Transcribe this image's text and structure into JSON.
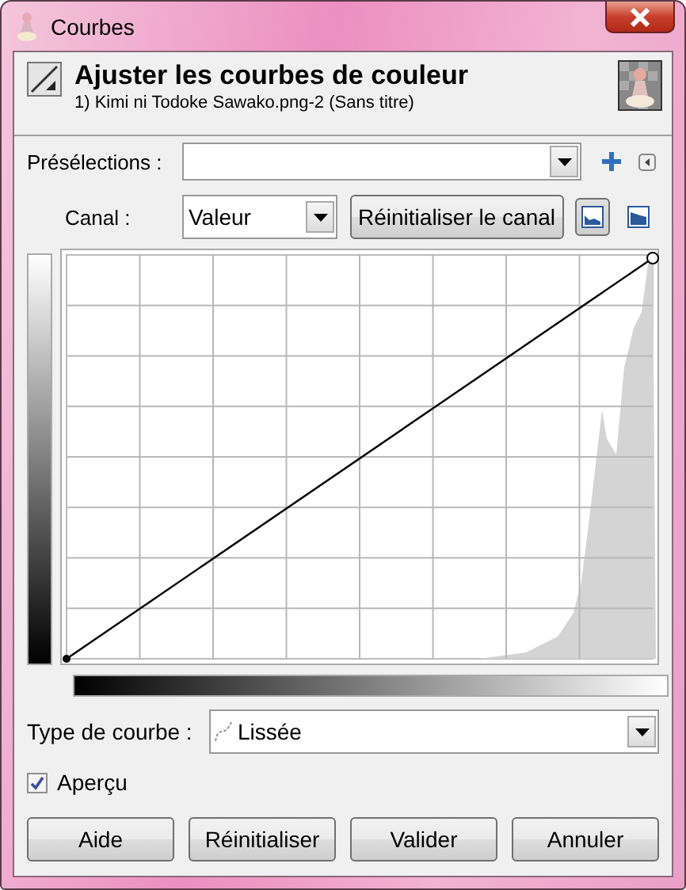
{
  "window": {
    "title": "Courbes"
  },
  "header": {
    "title": "Ajuster les courbes de couleur",
    "subtitle": "1) Kimi ni Todoke Sawako.png-2 (Sans titre)"
  },
  "presets": {
    "label": "Présélections :"
  },
  "channel": {
    "label": "Canal :",
    "value": "Valeur",
    "reset_button": "Réinitialiser le canal",
    "views": [
      {
        "kind": "linear",
        "selected": true
      },
      {
        "kind": "logarithmic",
        "selected": false
      }
    ]
  },
  "curve_type": {
    "label": "Type de courbe :",
    "value": "Lissée"
  },
  "preview": {
    "label": "Aperçu",
    "checked": true
  },
  "buttons": [
    "Aide",
    "Réinitialiser",
    "Valider",
    "Annuler"
  ]
}
